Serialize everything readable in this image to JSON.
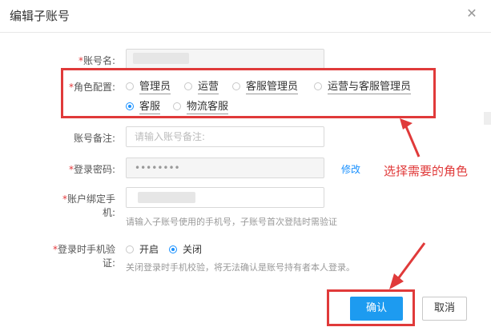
{
  "dialog": {
    "title": "编辑子账号",
    "close_icon": "close-icon"
  },
  "form": {
    "account_name": {
      "label": "账号名:",
      "required": true
    },
    "roles": {
      "label": "角色配置:",
      "required": true,
      "options": [
        {
          "label": "管理员",
          "checked": false
        },
        {
          "label": "运营",
          "checked": false
        },
        {
          "label": "客服管理员",
          "checked": false
        },
        {
          "label": "运营与客服管理员",
          "checked": false
        },
        {
          "label": "客服",
          "checked": true
        },
        {
          "label": "物流客服",
          "checked": false
        }
      ]
    },
    "remark": {
      "label": "账号备注:",
      "required": false,
      "placeholder": "请输入账号备注:"
    },
    "password": {
      "label": "登录密码:",
      "required": true,
      "value": "••••••••",
      "edit_link": "修改"
    },
    "phone": {
      "label": "账户绑定手机:",
      "required": true,
      "hint": "请输入子账号使用的手机号，子账号首次登陆时需验证"
    },
    "login_verify": {
      "label": "登录时手机验证:",
      "required": true,
      "options": [
        {
          "label": "开启",
          "checked": false
        },
        {
          "label": "关闭",
          "checked": true
        }
      ],
      "hint": "关闭登录时手机校验，将无法确认是账号持有者本人登录。"
    }
  },
  "annotation": {
    "text": "选择需要的角色",
    "color": "#e03a3a"
  },
  "buttons": {
    "confirm": "确认",
    "cancel": "取消"
  },
  "colors": {
    "primary": "#1d9bf0",
    "required": "#e4393c",
    "link": "#1890ff"
  }
}
